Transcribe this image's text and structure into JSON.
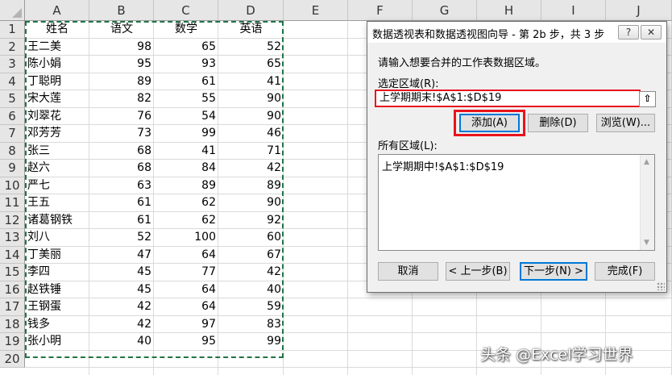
{
  "spreadsheet": {
    "columns": [
      "A",
      "B",
      "C",
      "D",
      "E",
      "F",
      "G",
      "H",
      "I",
      "J"
    ],
    "rows": [
      "1",
      "2",
      "3",
      "4",
      "5",
      "6",
      "7",
      "8",
      "9",
      "10",
      "11",
      "12",
      "13",
      "14",
      "15",
      "16",
      "17",
      "18",
      "19",
      "20"
    ],
    "header": [
      "姓名",
      "语文",
      "数学",
      "英语"
    ],
    "data": [
      [
        "王二美",
        "98",
        "65",
        "52"
      ],
      [
        "陈小娟",
        "95",
        "93",
        "65"
      ],
      [
        "丁聪明",
        "89",
        "61",
        "41"
      ],
      [
        "宋大莲",
        "82",
        "55",
        "90"
      ],
      [
        "刘翠花",
        "76",
        "54",
        "90"
      ],
      [
        "邓芳芳",
        "73",
        "99",
        "46"
      ],
      [
        "张三",
        "68",
        "41",
        "71"
      ],
      [
        "赵六",
        "68",
        "84",
        "42"
      ],
      [
        "严七",
        "63",
        "89",
        "89"
      ],
      [
        "王五",
        "61",
        "62",
        "90"
      ],
      [
        "诸葛钢铁",
        "61",
        "62",
        "92"
      ],
      [
        "刘八",
        "52",
        "100",
        "60"
      ],
      [
        "丁美丽",
        "47",
        "64",
        "67"
      ],
      [
        "李四",
        "45",
        "77",
        "42"
      ],
      [
        "赵铁锤",
        "45",
        "64",
        "40"
      ],
      [
        "王钢蛋",
        "42",
        "64",
        "59"
      ],
      [
        "钱多",
        "42",
        "97",
        "83"
      ],
      [
        "张小明",
        "40",
        "95",
        "99"
      ]
    ],
    "marquee_color": "#217346"
  },
  "dialog": {
    "title": "数据透视表和数据透视图向导 - 第 2b 步，共 3 步",
    "help_label": "?",
    "close_label": "✕",
    "instruction": "请输入想要合并的工作表数据区域。",
    "range_label": "选定区域(R):",
    "range_value": "上学期期末!$A$1:$D$19",
    "collapse_label": "⇧",
    "add_label": "添加(A)",
    "delete_label": "删除(D)",
    "browse_label": "浏览(W)...",
    "all_ranges_label": "所有区域(L):",
    "all_ranges": [
      "上学期期中!$A$1:$D$19"
    ],
    "cancel_label": "取消",
    "back_label": "< 上一步(B)",
    "next_label": "下一步(N) >",
    "finish_label": "完成(F)",
    "highlight_color": "#e8141c"
  },
  "watermark": "头条 @Excel学习世界"
}
